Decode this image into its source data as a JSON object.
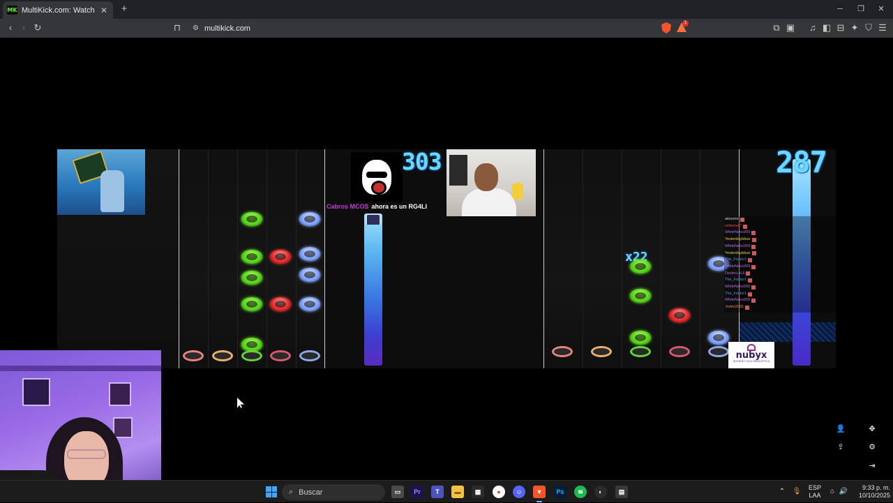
{
  "browser": {
    "tab": {
      "favicon": "MK",
      "title": "MultiKick.com: Watch Multipl"
    },
    "url": "multikick.com",
    "reward_count": "1"
  },
  "stream": {
    "score_left": "303",
    "score_right": "287",
    "notice": {
      "user": "Cabros MCOS",
      "message": "ahora es un RG4LI"
    },
    "combo": "x22",
    "chat": [
      {
        "name": "aitzoore",
        "color": "white"
      },
      {
        "name": "whitehell7",
        "color": "red"
      },
      {
        "name": "WhiteNeko269",
        "color": "purple"
      },
      {
        "name": "Yesterdaybbue",
        "color": "yellow"
      },
      {
        "name": "WhiteNeko269",
        "color": "purple"
      },
      {
        "name": "Yesterdaybbue",
        "color": "yellow"
      },
      {
        "name": "The_Fastor1",
        "color": "blue"
      },
      {
        "name": "WhiteNeko269",
        "color": "purple"
      },
      {
        "name": "DexterLoL6",
        "color": "purple"
      },
      {
        "name": "The_Fastor1",
        "color": "blue"
      },
      {
        "name": "WhiteNeko269",
        "color": "purple"
      },
      {
        "name": "The_Fastor1",
        "color": "blue"
      },
      {
        "name": "WhiteNeko269",
        "color": "purple"
      },
      {
        "name": "Joden2081",
        "color": "orange"
      }
    ],
    "sponsor": {
      "brand": "nubyx",
      "tagline": "INTERNET 100% FIBRA ÓPTICA"
    }
  },
  "taskbar": {
    "search_placeholder": "Buscar",
    "language": "ESP",
    "keyboard": "LAA",
    "time": "9:33 p. m.",
    "date": "10/10/2025"
  },
  "colors": {
    "accent_score": "#6ed6ff",
    "windows_blue": "#3ea6ff",
    "sponsor_purple": "#2f1b59"
  }
}
